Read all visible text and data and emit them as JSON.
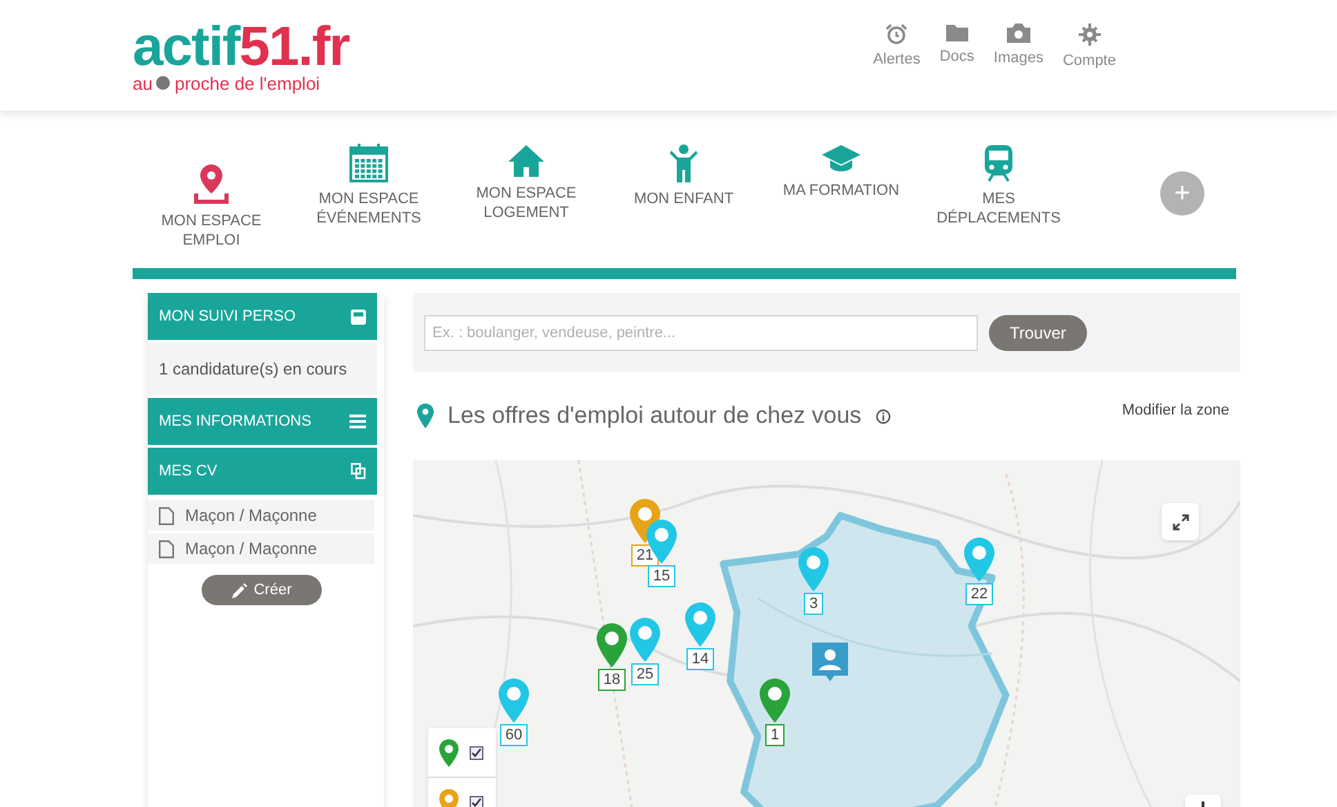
{
  "header": {
    "logo": {
      "main": "actif",
      "number": "51.fr",
      "tagline_before": "au",
      "tagline_after": "proche de l'emploi"
    },
    "tools": [
      {
        "kind": "alarm",
        "label": "Alertes"
      },
      {
        "kind": "folder",
        "label": "Docs"
      },
      {
        "kind": "camera",
        "label": "Images"
      },
      {
        "kind": "gear",
        "label": "Compte"
      }
    ]
  },
  "nav": {
    "items": [
      {
        "kind": "pin",
        "label": "MON ESPACE EMPLOI",
        "selected": true
      },
      {
        "kind": "calendar",
        "label": "MON ESPACE ÉVÉNEMENTS",
        "selected": false
      },
      {
        "kind": "house",
        "label": "MON ESPACE LOGEMENT",
        "selected": false
      },
      {
        "kind": "child",
        "label": "MON ENFANT",
        "selected": false
      },
      {
        "kind": "cap",
        "label": "MA FORMATION",
        "selected": false
      },
      {
        "kind": "train",
        "label": "MES DÉPLACEMENTS",
        "selected": false
      }
    ],
    "add_button": "+"
  },
  "sidebar": {
    "sections": [
      {
        "kind": "tracking",
        "title": "MON SUIVI PERSO",
        "lines": [
          "1 candidature(s) en cours"
        ]
      },
      {
        "kind": "info",
        "title": "MES INFORMATIONS"
      },
      {
        "kind": "cv",
        "title": "MES CV",
        "files": [
          "Maçon / Maçonne",
          "Maçon / Maçonne"
        ]
      }
    ],
    "create_button": "Créer"
  },
  "search": {
    "placeholder": "Ex. : boulanger, vendeuse, peintre...",
    "button": "Trouver"
  },
  "offers": {
    "title": "Les offres d'emploi autour de chez vous",
    "modify_link": "Modifier la zone"
  },
  "map": {
    "markers": [
      {
        "label": "21",
        "color": "#e8a317"
      },
      {
        "label": "15",
        "color": "#22c7e6"
      },
      {
        "label": "3",
        "color": "#22c7e6"
      },
      {
        "label": "22",
        "color": "#22c7e6"
      },
      {
        "label": "14",
        "color": "#22c7e6"
      },
      {
        "label": "18",
        "color": "#2aa33a"
      },
      {
        "label": "25",
        "color": "#22c7e6"
      },
      {
        "label": "60",
        "color": "#22c7e6"
      },
      {
        "label": "1",
        "color": "#2aa33a"
      }
    ],
    "legend": [
      {
        "color": "#2aa33a",
        "checked": true
      },
      {
        "color": "#e8a317",
        "checked": true
      }
    ]
  }
}
